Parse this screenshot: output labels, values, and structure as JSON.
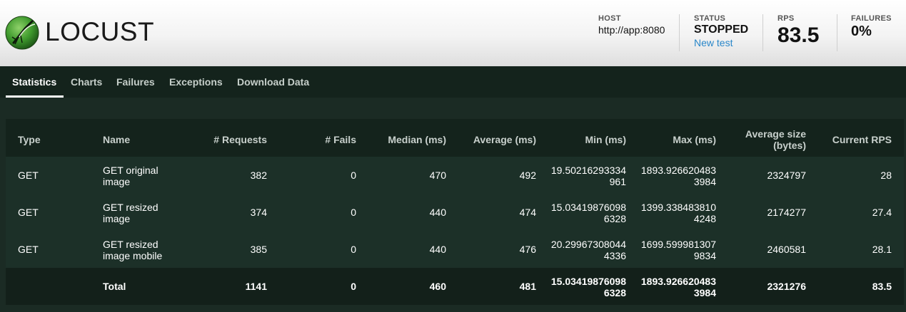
{
  "brand": {
    "name": "LOCUST"
  },
  "header": {
    "host": {
      "label": "HOST",
      "value": "http://app:8080"
    },
    "status": {
      "label": "STATUS",
      "value": "STOPPED",
      "new_test": "New test"
    },
    "rps": {
      "label": "RPS",
      "value": "83.5"
    },
    "failures": {
      "label": "FAILURES",
      "value": "0%"
    }
  },
  "tabs": [
    {
      "label": "Statistics",
      "active": true
    },
    {
      "label": "Charts"
    },
    {
      "label": "Failures"
    },
    {
      "label": "Exceptions"
    },
    {
      "label": "Download Data"
    }
  ],
  "table": {
    "columns": [
      "Type",
      "Name",
      "# Requests",
      "# Fails",
      "Median (ms)",
      "Average (ms)",
      "Min (ms)",
      "Max (ms)",
      "Average size (bytes)",
      "Current RPS"
    ],
    "rows": [
      {
        "type": "GET",
        "name": [
          "GET original",
          "image"
        ],
        "requests": "382",
        "fails": "0",
        "median": "470",
        "average": "492",
        "min": [
          "19.50216293334",
          "961"
        ],
        "max": [
          "1893.926620483",
          "3984"
        ],
        "avg_size": "2324797",
        "rps": "28"
      },
      {
        "type": "GET",
        "name": [
          "GET resized",
          "image"
        ],
        "requests": "374",
        "fails": "0",
        "median": "440",
        "average": "474",
        "min": [
          "15.03419876098",
          "6328"
        ],
        "max": [
          "1399.338483810",
          "4248"
        ],
        "avg_size": "2174277",
        "rps": "27.4"
      },
      {
        "type": "GET",
        "name": [
          "GET resized",
          "image mobile"
        ],
        "requests": "385",
        "fails": "0",
        "median": "440",
        "average": "476",
        "min": [
          "20.29967308044",
          "4336"
        ],
        "max": [
          "1699.599981307",
          "9834"
        ],
        "avg_size": "2460581",
        "rps": "28.1"
      }
    ],
    "total": {
      "type": "",
      "name": "Total",
      "requests": "1141",
      "fails": "0",
      "median": "460",
      "average": "481",
      "min": [
        "15.03419876098",
        "6328"
      ],
      "max": [
        "1893.926620483",
        "3984"
      ],
      "avg_size": "2321276",
      "rps": "83.5"
    }
  },
  "colors": {
    "background": "#1b2b24",
    "tab_bar": "#14231c",
    "row": "#1c3028",
    "link": "#2a87c9"
  },
  "icons": {
    "logo": "locust-logo-icon"
  }
}
